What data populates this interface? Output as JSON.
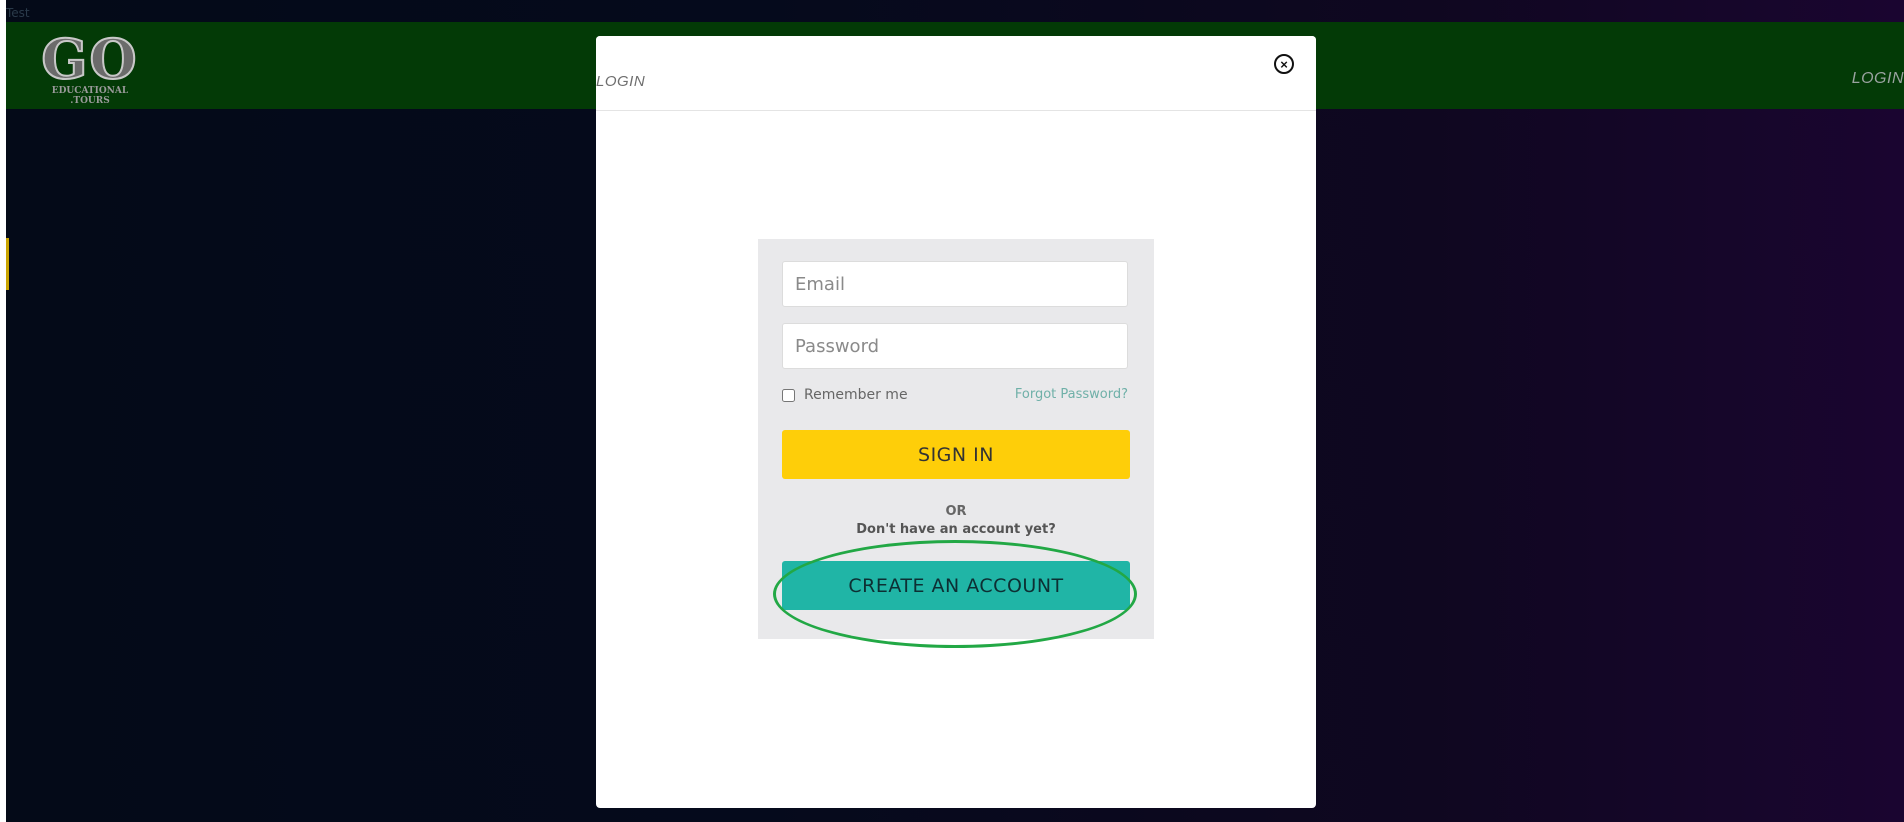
{
  "page": {
    "label": "Test"
  },
  "header": {
    "logo": {
      "main": "GO",
      "line1": "EDUCATIONAL",
      "line2": ".TOURS"
    },
    "nav_login": "LOGIN"
  },
  "modal": {
    "title": "LOGIN",
    "close_glyph": "×",
    "form": {
      "email_placeholder": "Email",
      "password_placeholder": "Password",
      "remember_label": "Remember me",
      "remember_checked": false,
      "forgot_label": "Forgot Password?",
      "signin_label": "SIGN IN",
      "or_label": "OR",
      "no_account_label": "Don't have an account yet?",
      "create_label": "CREATE AN ACCOUNT"
    }
  },
  "colors": {
    "header_bg": "#033a06",
    "signin": "#fece09",
    "create": "#20b5a6",
    "highlight": "#22a845",
    "link": "#6fb0a8"
  },
  "icons": {
    "close": "close-circle-icon"
  }
}
